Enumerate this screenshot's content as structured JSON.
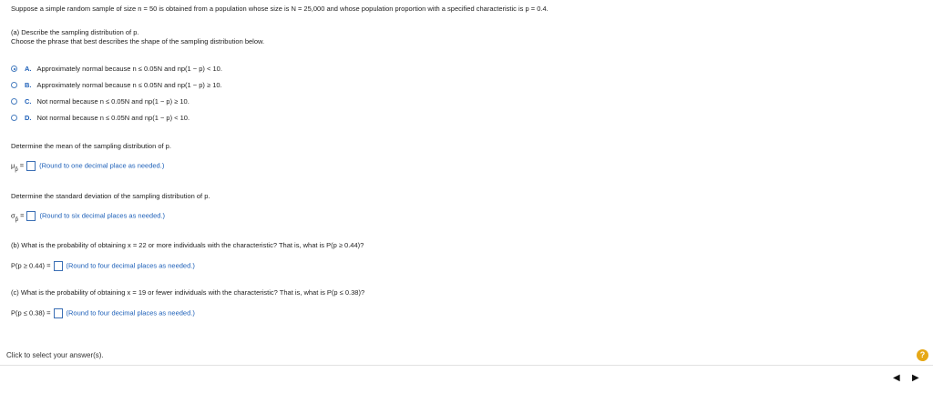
{
  "question": "Suppose a simple random sample of size n = 50 is obtained from a population whose size is N = 25,000 and whose population proportion with a specified characteristic is p = 0.4.",
  "partA": {
    "title": "(a) Describe the sampling distribution of p.",
    "instruction": "Choose the phrase that best describes the shape of the sampling distribution below.",
    "choices": [
      {
        "letter": "A.",
        "text": "Approximately normal because n ≤ 0.05N and np(1 − p) < 10.",
        "selected": true
      },
      {
        "letter": "B.",
        "text": "Approximately normal because n ≤ 0.05N and np(1 − p) ≥ 10.",
        "selected": false
      },
      {
        "letter": "C.",
        "text": "Not normal because n ≤ 0.05N and np(1 − p) ≥ 10.",
        "selected": false
      },
      {
        "letter": "D.",
        "text": "Not normal because n ≤ 0.05N and np(1 − p) < 10.",
        "selected": false
      }
    ],
    "mean_prompt": "Determine the mean of the sampling distribution of p.",
    "mean_symbol": "μ",
    "mean_hint": "(Round to one decimal place as needed.)",
    "sd_prompt": "Determine the standard deviation of the sampling distribution of p.",
    "sd_symbol": "σ",
    "sd_hint": "(Round to six decimal places as needed.)"
  },
  "partB": {
    "question": "(b) What is the probability of obtaining x = 22 or more individuals with the characteristic? That is, what is P(p ≥ 0.44)?",
    "label": "P(p ≥ 0.44) =",
    "hint": "(Round to four decimal places as needed.)"
  },
  "partC": {
    "question": "(c) What is the probability of obtaining x = 19 or fewer individuals with the characteristic? That is, what is P(p ≤ 0.38)?",
    "label": "P(p ≤ 0.38) =",
    "hint": "(Round to four decimal places as needed.)"
  },
  "footer": {
    "text": "Click to select your answer(s).",
    "help": "?"
  },
  "nav": {
    "prev": "◀",
    "next": "▶"
  },
  "colors": {
    "accent": "#1c5fb8",
    "help": "#e6a817"
  }
}
